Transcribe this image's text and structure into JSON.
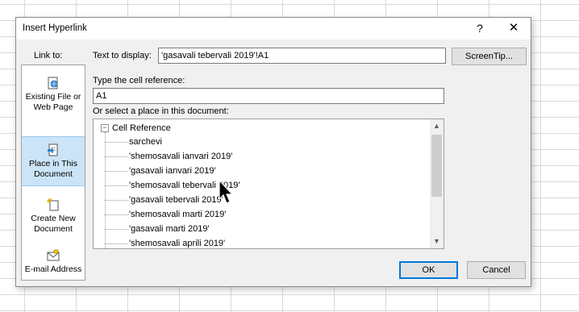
{
  "dialog": {
    "title": "Insert Hyperlink",
    "help_label": "?",
    "close_label": "✕"
  },
  "link_to": {
    "label": "Link to:",
    "items": [
      {
        "label": "Existing File or Web Page",
        "icon": "web-page-icon",
        "selected": false
      },
      {
        "label": "Place in This Document",
        "icon": "document-place-icon",
        "selected": true
      },
      {
        "label": "Create New Document",
        "icon": "new-document-icon",
        "selected": false
      },
      {
        "label": "E-mail Address",
        "icon": "email-icon",
        "selected": false
      }
    ]
  },
  "text_to_display": {
    "label": "Text to display:",
    "value": "'gasavali tebervali 2019'!A1"
  },
  "screentip_button": "ScreenTip...",
  "cell_reference": {
    "label": "Type the cell reference:",
    "value": "A1"
  },
  "place": {
    "label": "Or select a place in this document:",
    "root_label": "Cell Reference",
    "root_toggle": "−",
    "items": [
      "sarchevi",
      "'shemosavali ianvari 2019'",
      "'gasavali ianvari 2019'",
      "'shemosavali tebervali 2019'",
      "'gasavali tebervali 2019'",
      "'shemosavali marti 2019'",
      "'gasavali marti 2019'",
      "'shemosavali aprili 2019'"
    ]
  },
  "scrollbar": {
    "up": "▲",
    "down": "▼"
  },
  "buttons": {
    "ok": "OK",
    "cancel": "Cancel"
  },
  "colors": {
    "selected_bg": "#cce4f7",
    "default_button_border": "#0078d7"
  }
}
